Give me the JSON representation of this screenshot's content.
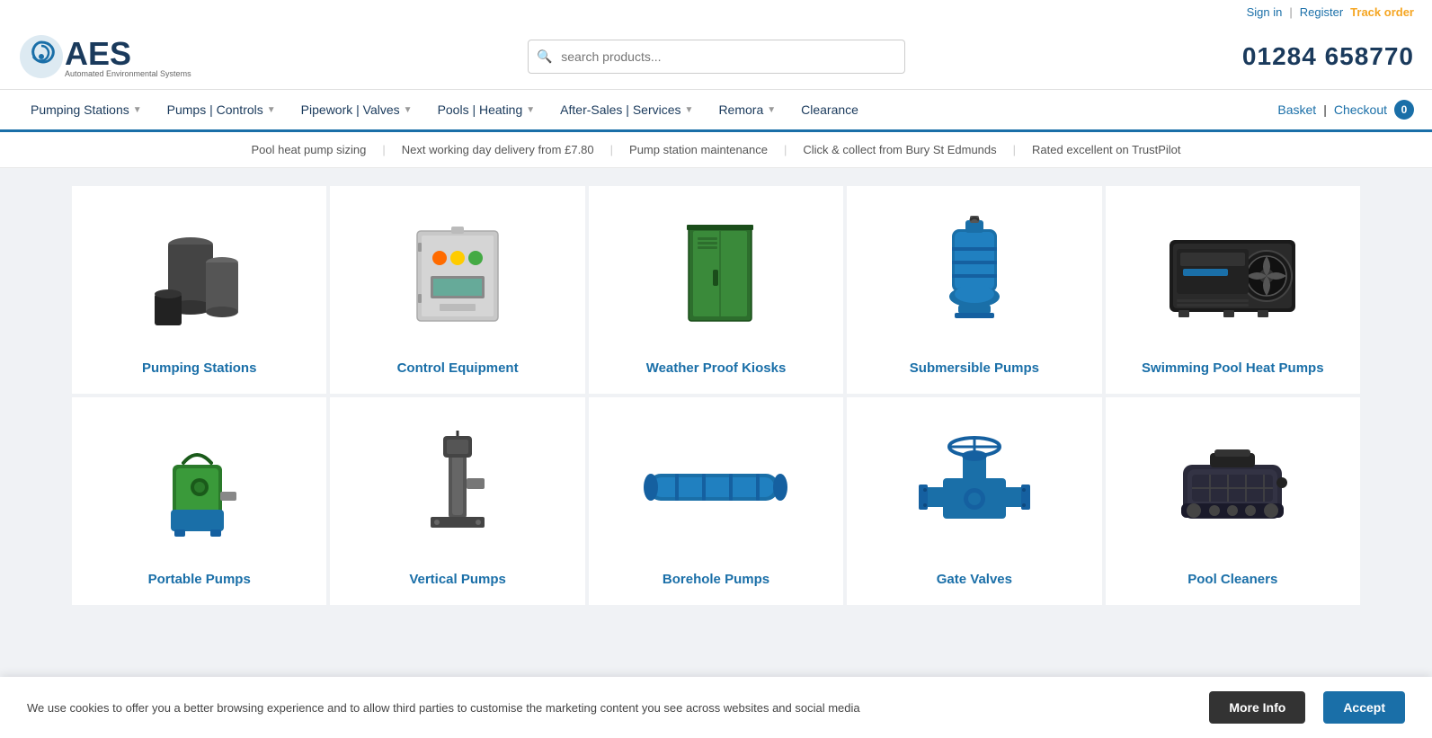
{
  "topbar": {
    "signin_label": "Sign in",
    "register_label": "Register",
    "track_order_label": "Track order"
  },
  "header": {
    "logo_brand": "AES",
    "logo_subtitle": "Automated Environmental Systems",
    "search_placeholder": "search products...",
    "phone": "01284 658770"
  },
  "nav": {
    "items": [
      {
        "label": "Pumping Stations",
        "has_dropdown": true
      },
      {
        "label": "Pumps | Controls",
        "has_dropdown": true
      },
      {
        "label": "Pipework | Valves",
        "has_dropdown": true
      },
      {
        "label": "Pools | Heating",
        "has_dropdown": true
      },
      {
        "label": "After-Sales | Services",
        "has_dropdown": true
      },
      {
        "label": "Remora",
        "has_dropdown": true
      },
      {
        "label": "Clearance",
        "has_dropdown": false
      }
    ],
    "basket_label": "Basket",
    "checkout_label": "Checkout",
    "cart_count": "0"
  },
  "infobar": {
    "items": [
      "Pool heat pump sizing",
      "Next working day delivery from £7.80",
      "Pump station maintenance",
      "Click & collect from Bury St Edmunds",
      "Rated excellent on TrustPilot"
    ]
  },
  "products": {
    "row1": [
      {
        "label": "Pumping Stations",
        "color": "#1a6fa8"
      },
      {
        "label": "Control Equipment",
        "color": "#1a6fa8"
      },
      {
        "label": "Weather Proof Kiosks",
        "color": "#1a6fa8"
      },
      {
        "label": "Submersible Pumps",
        "color": "#1a6fa8"
      },
      {
        "label": "Swimming Pool Heat Pumps",
        "color": "#1a6fa8"
      }
    ],
    "row2": [
      {
        "label": "Portable Pumps",
        "color": "#1a6fa8"
      },
      {
        "label": "Vertical Pumps",
        "color": "#1a6fa8"
      },
      {
        "label": "Borehole Pumps",
        "color": "#1a6fa8"
      },
      {
        "label": "Gate Valves",
        "color": "#1a6fa8"
      },
      {
        "label": "Pool Cleaners",
        "color": "#1a6fa8"
      }
    ]
  },
  "cookie": {
    "text": "We use cookies to offer you a better browsing experience and to allow third parties to customise the marketing content you see across websites and social media",
    "more_info_label": "More Info",
    "accept_label": "Accept"
  }
}
